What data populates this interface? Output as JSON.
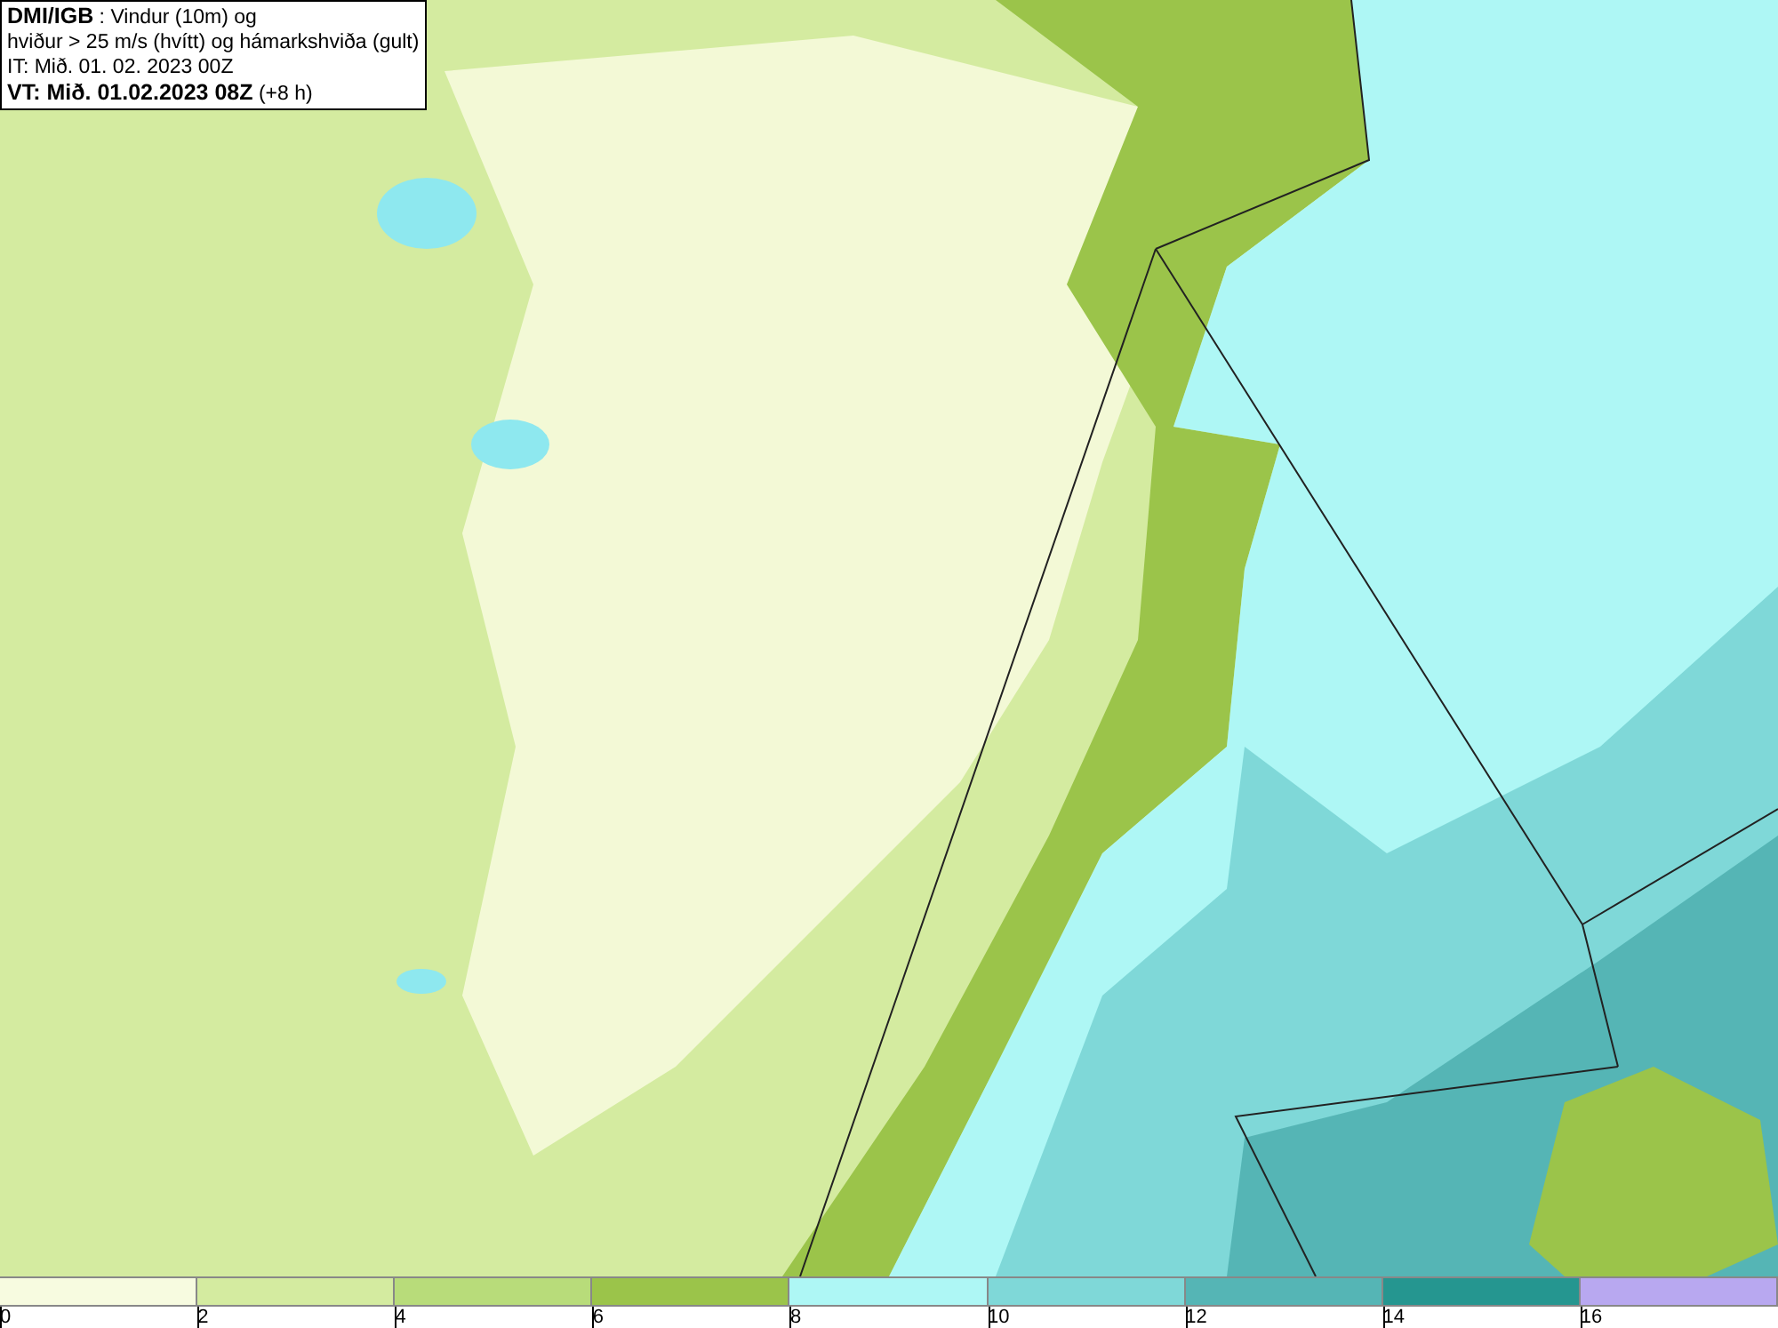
{
  "header": {
    "source": "DMI/IGB",
    "title_rest": " : Vindur (10m) og",
    "line_2": "hviður > 25 m/s (hvítt) og hámarkshviða (gult)",
    "issue_time": "IT: Mið. 01. 02. 2023 00Z",
    "valid_time": "VT: Mið. 01.02.2023 08Z",
    "lead": " (+8 h)"
  },
  "legend": {
    "bins": [
      {
        "from": "0",
        "color": "#f7fbe0"
      },
      {
        "from": "2",
        "color": "#d4eba0"
      },
      {
        "from": "4",
        "color": "#b8dc7a"
      },
      {
        "from": "6",
        "color": "#9bc44a"
      },
      {
        "from": "8",
        "color": "#aef7f5"
      },
      {
        "from": "10",
        "color": "#7fd8d8"
      },
      {
        "from": "12",
        "color": "#55b5b5"
      },
      {
        "from": "14",
        "color": "#259690"
      },
      {
        "from": "16",
        "color": "#b8a8f0"
      }
    ]
  }
}
